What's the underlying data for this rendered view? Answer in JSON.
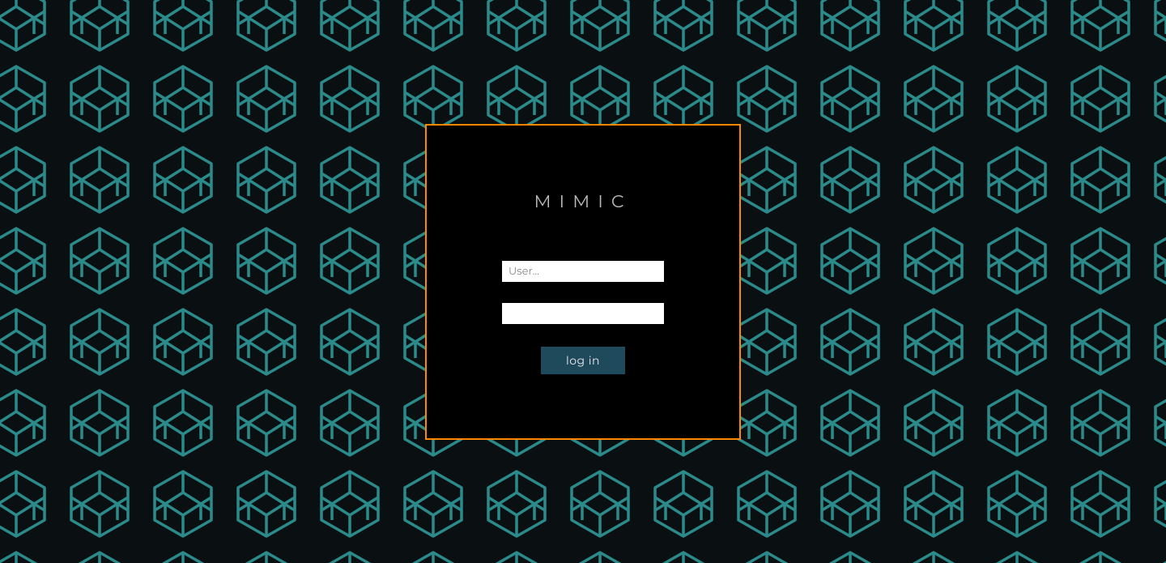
{
  "brand": {
    "title": "MIMIC"
  },
  "form": {
    "username": {
      "placeholder": "User...",
      "value": ""
    },
    "password": {
      "placeholder": "",
      "value": ""
    },
    "login_label": "log in"
  },
  "theme": {
    "accent_border": "#ff8800",
    "button_bg": "#1f4a5c",
    "pattern_stroke": "#2b8a8a",
    "page_bg": "#0a0f12"
  }
}
